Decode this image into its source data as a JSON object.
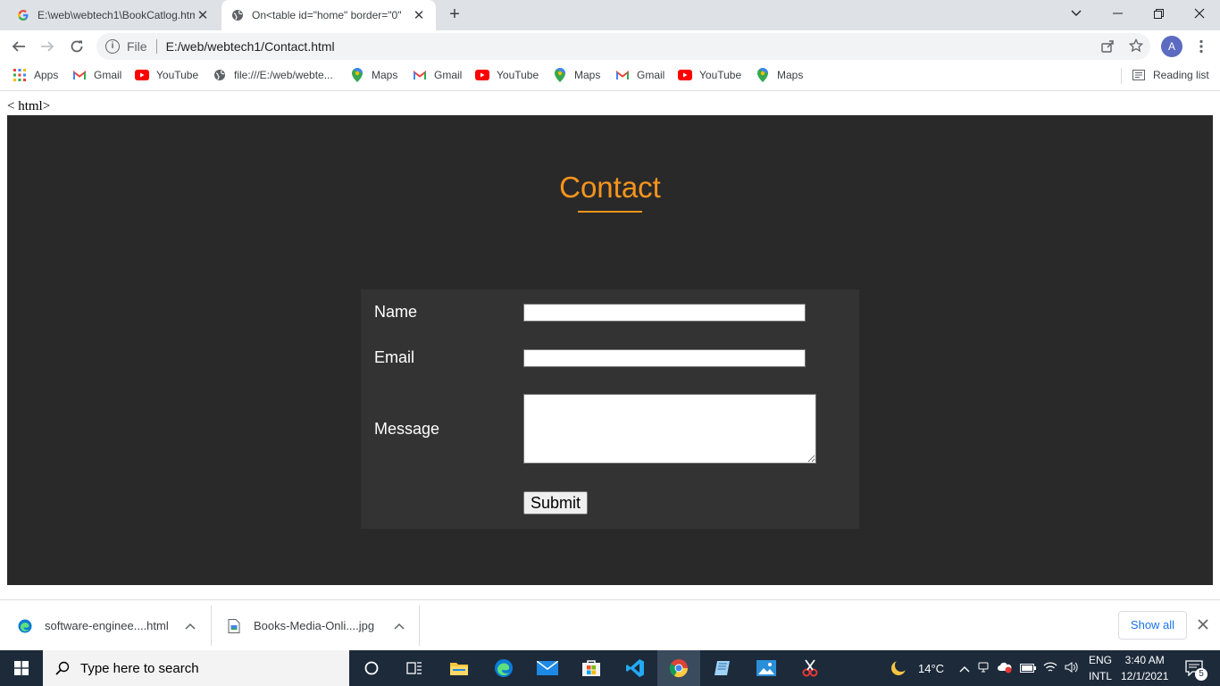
{
  "browser": {
    "tabs": [
      {
        "title": "E:\\web\\webtech1\\BookCatlog.htm",
        "active": false
      },
      {
        "title": "On<table id=\"home\" border=\"0\"",
        "active": true
      }
    ],
    "address": {
      "scheme_label": "File",
      "url": "E:/web/webtech1/Contact.html"
    },
    "profile_initial": "A",
    "bookmarks": [
      {
        "label": "Apps",
        "icon": "apps-grid-icon"
      },
      {
        "label": "Gmail",
        "icon": "gmail-icon"
      },
      {
        "label": "YouTube",
        "icon": "youtube-icon"
      },
      {
        "label": "file:///E:/web/webte...",
        "icon": "globe-icon"
      },
      {
        "label": "Maps",
        "icon": "maps-pin-icon"
      },
      {
        "label": "Gmail",
        "icon": "gmail-icon"
      },
      {
        "label": "YouTube",
        "icon": "youtube-icon"
      },
      {
        "label": "Maps",
        "icon": "maps-pin-icon"
      },
      {
        "label": "Gmail",
        "icon": "gmail-icon"
      },
      {
        "label": "YouTube",
        "icon": "youtube-icon"
      },
      {
        "label": "Maps",
        "icon": "maps-pin-icon"
      }
    ],
    "reading_list": "Reading list"
  },
  "page": {
    "stray_text": "< html>",
    "title": "Contact",
    "form": {
      "name_label": "Name",
      "email_label": "Email",
      "message_label": "Message",
      "name_value": "",
      "email_value": "",
      "message_value": "",
      "submit_label": "Submit"
    },
    "colors": {
      "background": "#292929",
      "form_bg": "#333333",
      "accent": "#f7941d"
    }
  },
  "downloads": {
    "items": [
      {
        "name": "software-enginee....html",
        "icon": "edge-file-icon"
      },
      {
        "name": "Books-Media-Onli....jpg",
        "icon": "image-file-icon"
      }
    ],
    "show_all": "Show all"
  },
  "taskbar": {
    "search_placeholder": "Type here to search",
    "weather": "14°C",
    "language": "ENG",
    "keyboard": "INTL",
    "time": "3:40 AM",
    "date": "12/1/2021",
    "notification_count": "5"
  }
}
